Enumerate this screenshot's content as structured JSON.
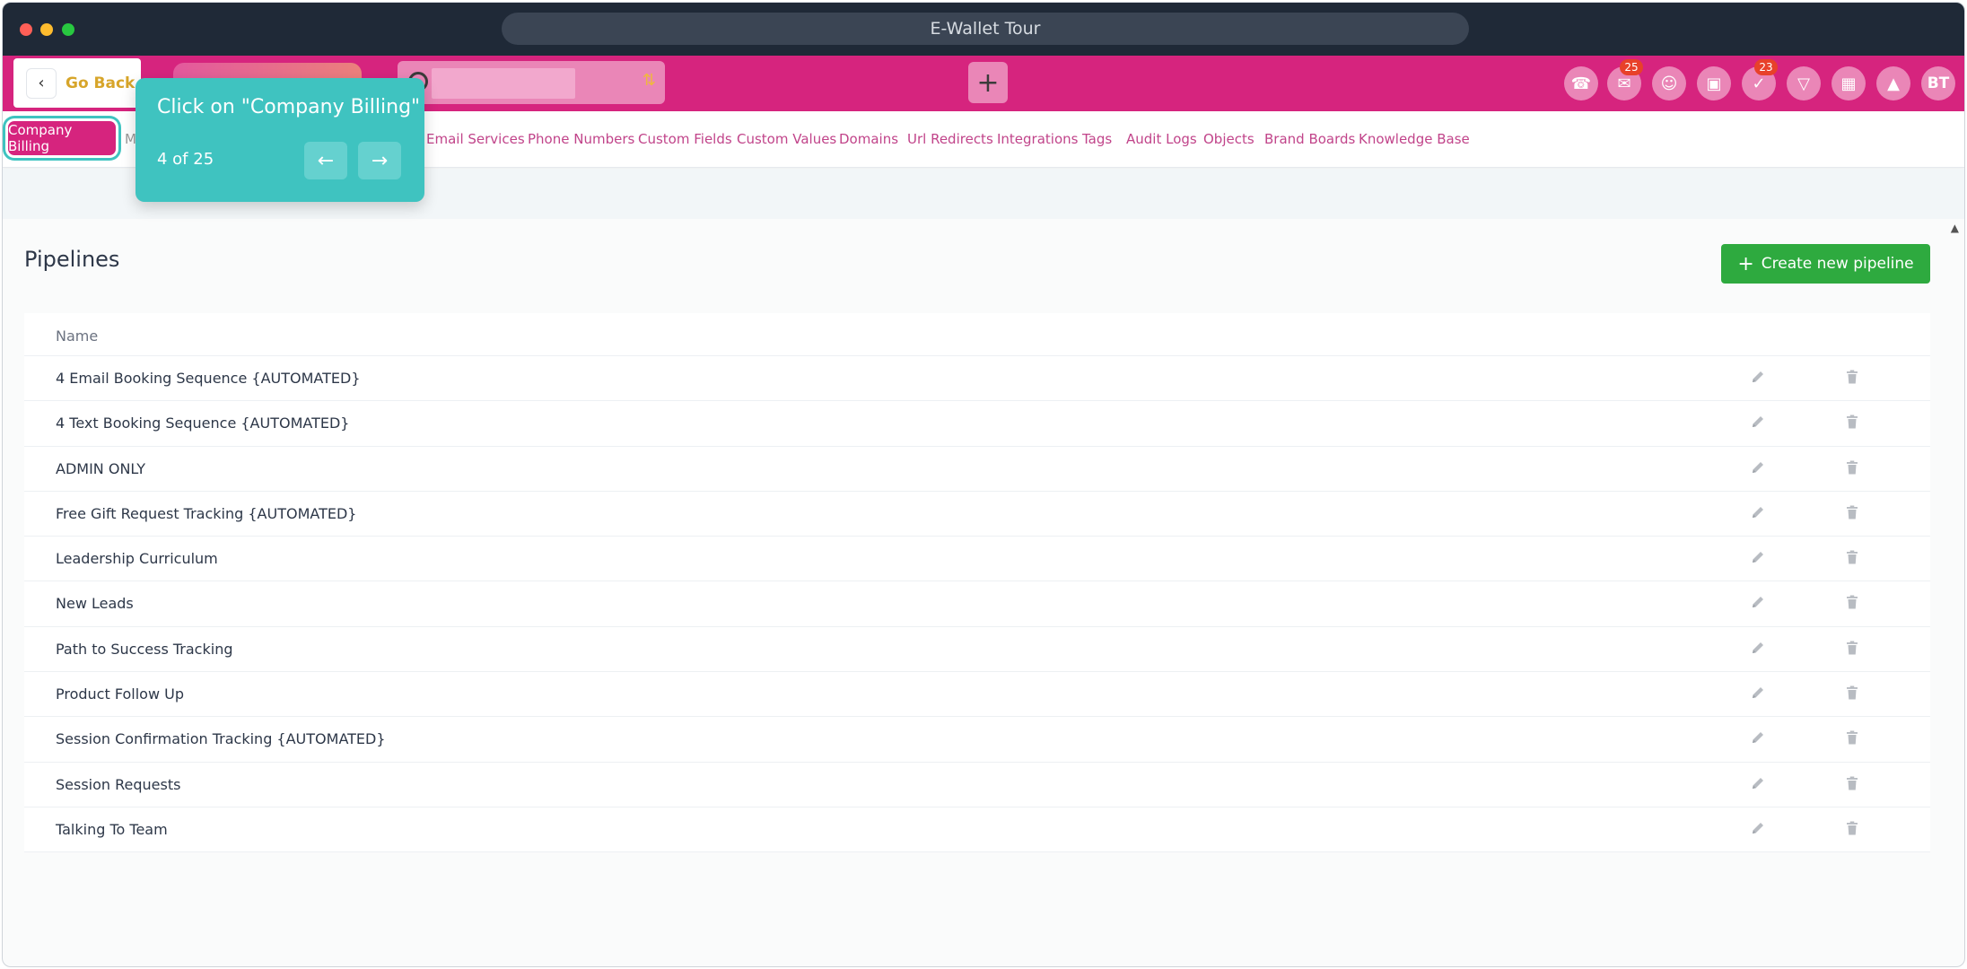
{
  "browser": {
    "window_title": "E-Wallet Tour"
  },
  "header": {
    "go_back_label": "Go Back",
    "quick_add_label": "+",
    "icons": [
      "phone-icon",
      "inbox-icon",
      "user-icon",
      "briefcase-icon",
      "tasks-icon",
      "megaphone-icon",
      "calendar-icon",
      "bell-icon"
    ],
    "badges": {
      "inbox": "25",
      "tasks": "23"
    },
    "avatar_initials": "BT",
    "colors": {
      "brand": "#d6247e",
      "tour": "#3fc3c0",
      "primary_action": "#2eaa3f"
    }
  },
  "settings_nav": {
    "active_item": "Company Billing",
    "partial_item": "M",
    "items": [
      "Email Services",
      "Phone Numbers",
      "Custom Fields",
      "Custom Values",
      "Domains",
      "Url Redirects",
      "Integrations",
      "Tags",
      "Audit Logs",
      "Objects",
      "Brand Boards",
      "Knowledge Base"
    ]
  },
  "tour": {
    "title": "Click on \"Company Billing\"",
    "step": "4 of 25",
    "prev_icon": "arrow-left-icon",
    "next_icon": "arrow-right-icon"
  },
  "pipelines": {
    "title": "Pipelines",
    "create_label": "Create new pipeline",
    "column_name": "Name",
    "rows": [
      "4 Email Booking Sequence {AUTOMATED}",
      "4 Text Booking Sequence {AUTOMATED}",
      "ADMIN ONLY",
      "Free Gift Request Tracking {AUTOMATED}",
      "Leadership Curriculum",
      "New Leads",
      "Path to Success Tracking",
      "Product Follow Up",
      "Session Confirmation Tracking {AUTOMATED}",
      "Session Requests",
      "Talking To Team"
    ]
  }
}
